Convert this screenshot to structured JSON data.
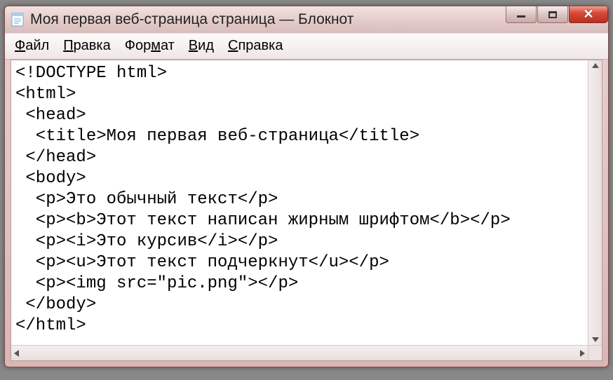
{
  "window": {
    "title": "Моя первая веб-страница страница — Блокнот"
  },
  "menu": {
    "file": {
      "label": "айл",
      "hotkey": "Ф"
    },
    "edit": {
      "label": "равка",
      "hotkey": "П"
    },
    "format": {
      "label_pre": "Фор",
      "hotkey": "м",
      "label_post": "ат"
    },
    "view": {
      "label": "ид",
      "hotkey": "В"
    },
    "help": {
      "label": "правка",
      "hotkey": "С"
    }
  },
  "editor": {
    "lines": [
      "<!DOCTYPE html>",
      "<html>",
      " <head>",
      "  <title>Моя первая веб-страница</title>",
      " </head>",
      " <body>",
      "  <p>Это обычный текст</p>",
      "  <p><b>Этот текст написан жирным шрифтом</b></p>",
      "  <p><i>Это курсив</i></p>",
      "  <p><u>Этот текст подчеркнут</u></p>",
      "  <p><img src=\"pic.png\"></p>",
      " </body>",
      "</html>"
    ]
  }
}
